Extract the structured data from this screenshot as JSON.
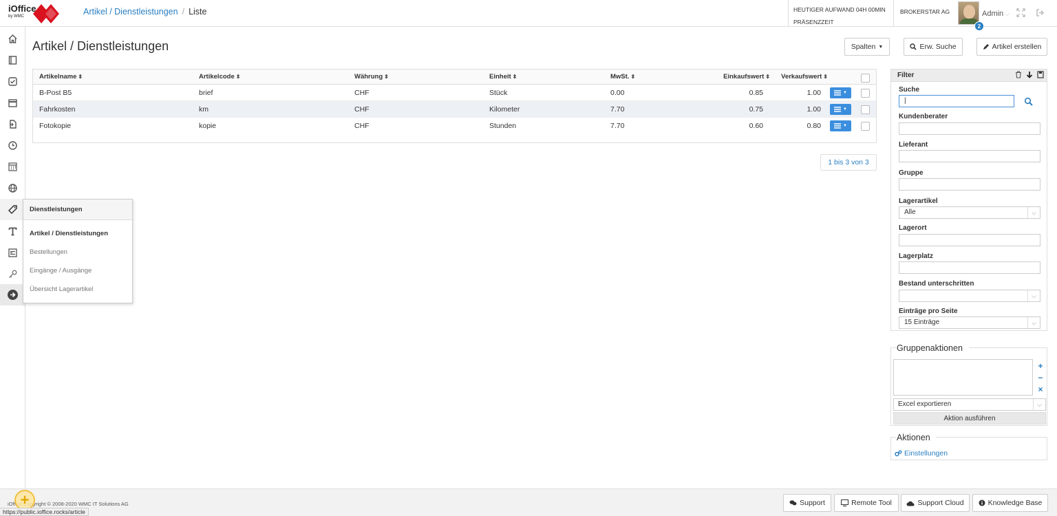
{
  "header": {
    "logo_text": "iOffice",
    "logo_byline": "by WMC",
    "breadcrumb": {
      "parent": "Artikel / Dienstleistungen",
      "current": "Liste"
    },
    "info_line1": "HEUTIGER AUFWAND 04H 00MIN",
    "info_line2": "PRÄSENZZEIT",
    "company": "BROKERSTAR AG",
    "user": "Admin",
    "notification_count": "2"
  },
  "sidebar": {
    "icons": [
      "home-icon",
      "book-icon",
      "check-square-icon",
      "calendar-icon",
      "document-icon",
      "clock-icon",
      "ledger-icon",
      "globe-icon",
      "tag-icon",
      "text-icon",
      "form-icon",
      "key-icon",
      "arrow-right-circle-icon"
    ]
  },
  "flyout": {
    "title": "Dienstleistungen",
    "items": [
      "Artikel / Dienstleistungen",
      "Bestellungen",
      "Eingänge / Ausgänge",
      "Übersicht Lagerartikel"
    ]
  },
  "page": {
    "title": "Artikel / Dienstleistungen",
    "columns_button": "Spalten",
    "advanced_search_button": "Erw. Suche",
    "create_button": "Artikel erstellen"
  },
  "table": {
    "headers": [
      "Artikelname",
      "Artikelcode",
      "Währung",
      "Einheit",
      "MwSt.",
      "Einkaufswert",
      "Verkaufswert"
    ],
    "rows": [
      [
        "B-Post B5",
        "brief",
        "CHF",
        "Stück",
        "0.00",
        "0.85",
        "1.00"
      ],
      [
        "Fahrkosten",
        "km",
        "CHF",
        "Kilometer",
        "7.70",
        "0.75",
        "1.00"
      ],
      [
        "Fotokopie",
        "kopie",
        "CHF",
        "Stunden",
        "7.70",
        "0.60",
        "0.80"
      ]
    ],
    "pager": "1 bis 3 von 3"
  },
  "filter": {
    "title": "Filter",
    "labels": {
      "search": "Suche",
      "advisor": "Kundenberater",
      "supplier": "Lieferant",
      "group": "Gruppe",
      "stock_item": "Lagerartikel",
      "location": "Lagerort",
      "slot": "Lagerplatz",
      "below_stock": "Bestand unterschritten",
      "per_page": "Einträge pro Seite"
    },
    "values": {
      "stock_item": "Alle",
      "per_page": "15 Einträge"
    }
  },
  "group_actions": {
    "title": "Gruppenaktionen",
    "select_value": "Excel exportieren",
    "run_button": "Aktion ausführen"
  },
  "actions": {
    "title": "Aktionen",
    "settings_link": "Einstellungen"
  },
  "footer": {
    "copyright": "iOffice Copyright © 2008-2020 WMC IT Solutions AG",
    "buttons": [
      "Support",
      "Remote Tool",
      "Support Cloud",
      "Knowledge Base"
    ],
    "status_url": "https://public.ioffice.rocks/article"
  },
  "colors": {
    "link": "#2a7fc1",
    "action_button": "#3b8ede",
    "logo_red": "#d9121f",
    "alt_row": "#edf1f6"
  }
}
